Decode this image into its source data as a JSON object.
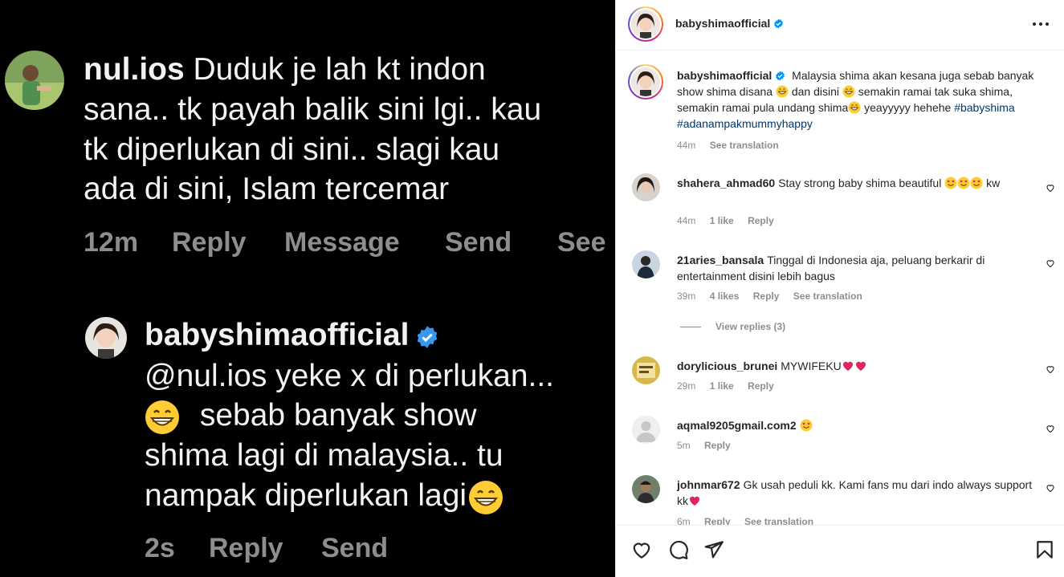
{
  "media": {
    "comment1": {
      "username": "nul.ios",
      "lines": [
        "Duduk je lah kt indon",
        "sana.. tk payah balik sini lgi.. kau",
        "tk diperlukan di sini.. slagi kau",
        "ada di sini, Islam tercemar"
      ],
      "time": "12m",
      "reply": "Reply",
      "message": "Message",
      "send": "Send",
      "see": "See"
    },
    "comment2": {
      "username": "babyshimaofficial",
      "line1": "@nul.ios yeke x di perlukan...",
      "line2": "sebab banyak show",
      "line3": "shima lagi di malaysia.. tu",
      "line4": "nampak diperlukan lagi",
      "time": "2s",
      "reply": "Reply",
      "send": "Send"
    }
  },
  "post": {
    "author": "babyshimaofficial",
    "caption": {
      "username": "babyshimaofficial",
      "part1": "Malaysia shima akan kesana juga sebab banyak show shima disana",
      "part2": "dan disini",
      "part3": "semakin ramai tak suka shima, semakin ramai pula undang shima",
      "part4": "yeayyyyy hehehe",
      "tag1": "#babyshima",
      "tag2": "#adanampakmummyhappy",
      "time": "44m",
      "see_translation": "See translation"
    },
    "comments": [
      {
        "username": "shahera_ahmad60",
        "text": "Stay strong baby shima beautiful",
        "text_after": "kw",
        "time": "44m",
        "likes": "1 like",
        "reply": "Reply"
      },
      {
        "username": "21aries_bansala",
        "text": "Tinggal di Indonesia aja, peluang berkarir di entertainment disini lebih bagus",
        "time": "39m",
        "likes": "4 likes",
        "reply": "Reply",
        "see_translation": "See translation"
      },
      {
        "username": "dorylicious_brunei",
        "text": "MYWIFEKU",
        "time": "29m",
        "likes": "1 like",
        "reply": "Reply"
      },
      {
        "username": "aqmal9205gmail.com2",
        "text": "",
        "time": "5m",
        "reply": "Reply"
      },
      {
        "username": "johnmar672",
        "text": "Gk usah peduli kk. Kami fans mu dari indo always support kk",
        "time": "6m",
        "reply": "Reply",
        "see_translation": "See translation"
      }
    ],
    "view_replies": "View replies (3)"
  },
  "colors": {
    "accent": "#0095f6",
    "link": "#00376b",
    "muted": "#8e8e8e",
    "heart": "#ed4956"
  }
}
